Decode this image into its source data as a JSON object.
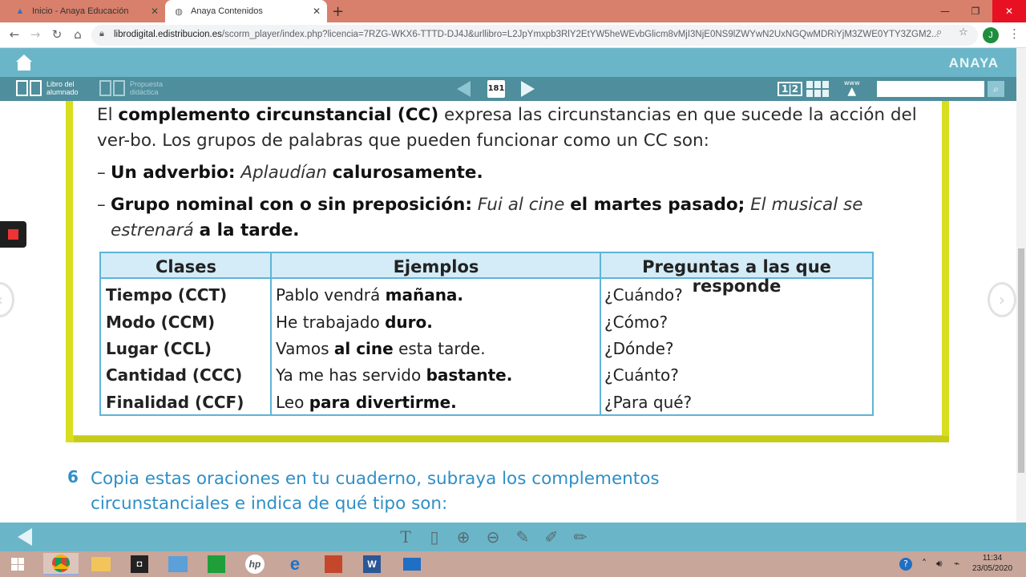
{
  "browser": {
    "tabs": [
      {
        "title": "Inicio - Anaya Educación",
        "icon": "anaya-favicon"
      },
      {
        "title": "Anaya Contenidos",
        "icon": "globe-icon",
        "active": true
      }
    ],
    "url_host": "librodigital.edistribucion.es",
    "url_path": "/scorm_player/index.php?licencia=7RZG-WKX6-TTTD-DJ4J&urllibro=L2JpYmxpb3RlY2EtYW5heWEvbGlicm8vMjI3NjE0NS9lZWYwN2UxNGQwMDRiYjM3ZWE0YTY3ZGM2...",
    "profile_initial": "J"
  },
  "app": {
    "brand": "ANAYA",
    "toolbar": {
      "libro_label": "Libro del alumnado",
      "propuesta_label": "Propuesta didáctica",
      "page_number": "181",
      "view_label": "1|2",
      "www_label": "www"
    }
  },
  "content": {
    "paragraph": {
      "p1": "El ",
      "p1_bold": "complemento circunstancial (CC)",
      "p1_rest": " expresa las circunstancias en que sucede la acción del ver-bo. Los grupos de palabras que pueden funcionar como un CC son:"
    },
    "bullets": [
      {
        "dash": "–",
        "head": "Un adverbio:",
        "ex_italic": "Aplaudían",
        "ex_bold": "calurosamente."
      },
      {
        "dash": "–",
        "head": "Grupo nominal con o sin preposición:",
        "ex_italic": "Fui al cine",
        "ex_bold": "el martes pasado;",
        "ex_italic2": "El musical se estrenará",
        "ex_bold2": "a la tarde."
      }
    ],
    "table": {
      "headers": [
        "Clases",
        "Ejemplos",
        "Preguntas a las que responde"
      ],
      "rows": [
        {
          "clase": "Tiempo (CCT)",
          "ej_pre": "Pablo vendrá ",
          "ej_bold": "mañana.",
          "ej_post": "",
          "pregunta": "¿Cuándo?"
        },
        {
          "clase": "Modo (CCM)",
          "ej_pre": "He trabajado ",
          "ej_bold": "duro.",
          "ej_post": "",
          "pregunta": "¿Cómo?"
        },
        {
          "clase": "Lugar (CCL)",
          "ej_pre": "Vamos ",
          "ej_bold": "al cine",
          "ej_post": " esta tarde.",
          "pregunta": "¿Dónde?"
        },
        {
          "clase": "Cantidad (CCC)",
          "ej_pre": "Ya me has servido ",
          "ej_bold": "bastante.",
          "ej_post": "",
          "pregunta": "¿Cuánto?"
        },
        {
          "clase": "Finalidad (CCF)",
          "ej_pre": "Leo ",
          "ej_bold": "para divertirme.",
          "ej_post": "",
          "pregunta": "¿Para qué?"
        }
      ]
    },
    "exercise": {
      "number": "6",
      "text": "Copia estas oraciones en tu cuaderno, subraya los complementos circunstanciales e indica de qué tipo son:"
    }
  },
  "taskbar": {
    "time": "11:34",
    "date": "23/05/2020"
  },
  "colors": {
    "accent_teal": "#6ab6c8",
    "frame_yellow": "#d8de1f",
    "table_blue": "#5fb4d6",
    "exercise_blue": "#2f8fc6"
  }
}
